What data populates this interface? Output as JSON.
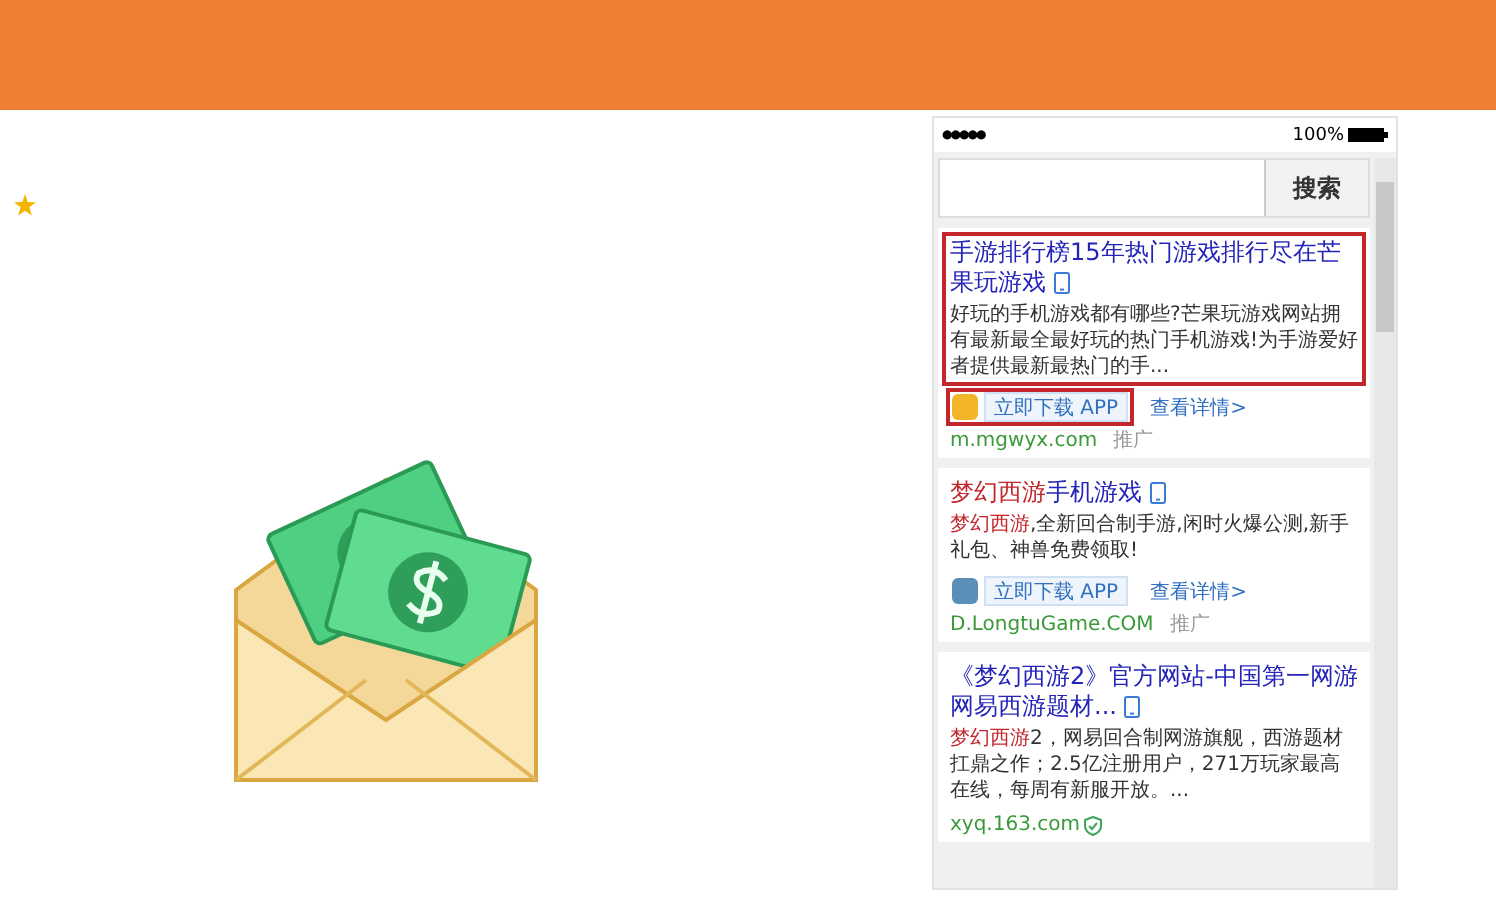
{
  "phone": {
    "status": {
      "signal_dots": "●●●●●",
      "battery": "100%"
    },
    "search": {
      "button": "搜索"
    },
    "results": [
      {
        "outlined": true,
        "title": [
          {
            "text": "手游排行榜15年热门游戏排行尽在芒果玩游戏",
            "hit": false
          }
        ],
        "description": [
          {
            "text": "好玩的手机游戏都有哪些?芒果玩游戏网站拥有最新最全最好玩的热门手机游戏!为手游爱好者提供最新最热门的手...",
            "hit": false
          }
        ],
        "app": {
          "outlined": true,
          "download": "立即下载 APP",
          "details": "查看详情>"
        },
        "url": "m.mgwyx.com",
        "ad": "推广",
        "verified": false
      },
      {
        "outlined": false,
        "title": [
          {
            "text": "梦幻西游",
            "hit": true
          },
          {
            "text": "手机游戏",
            "hit": false
          }
        ],
        "description": [
          {
            "text": "梦幻西游",
            "hit": true
          },
          {
            "text": ",全新回合制手游,闲时火爆公测,新手礼包、神兽免费领取!",
            "hit": false
          }
        ],
        "app": {
          "outlined": false,
          "download": "立即下载 APP",
          "details": "查看详情>"
        },
        "url": "D.LongtuGame.COM",
        "ad": "推广",
        "verified": false
      },
      {
        "outlined": false,
        "title": [
          {
            "text": "《梦幻西游2》官方网站-中国第一网游网易西游题材...",
            "hit": false
          }
        ],
        "description": [
          {
            "text": "梦幻西游",
            "hit": true
          },
          {
            "text": "2，网易回合制网游旗舰，西游题材扛鼎之作；2.5亿注册用户，271万玩家最高在线，每周有新服开放。...",
            "hit": false
          }
        ],
        "url": "xyq.163.com",
        "verified": true
      }
    ]
  }
}
